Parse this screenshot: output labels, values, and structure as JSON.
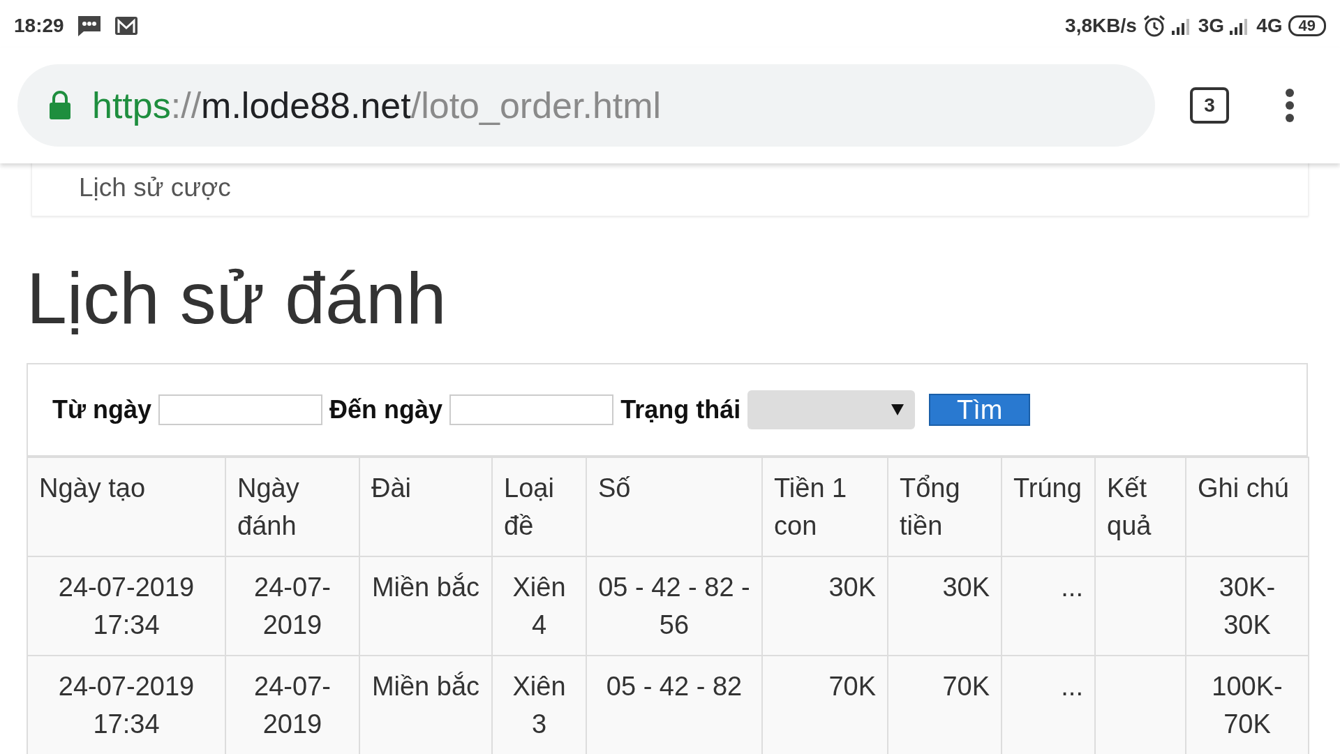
{
  "status_bar": {
    "time": "18:29",
    "speed": "3,8KB/s",
    "network_1": "3G",
    "network_2": "4G",
    "battery": "49"
  },
  "browser": {
    "url_scheme": "https",
    "url_sep": "://",
    "url_host": "m.lode88.net",
    "url_path": "/loto_order.html",
    "tab_count": "3"
  },
  "breadcrumb": "Lịch sử cược",
  "heading": "Lịch sử đánh",
  "filter": {
    "from_label": "Từ ngày",
    "to_label": "Đến ngày",
    "status_label": "Trạng thái",
    "search_button": "Tìm"
  },
  "table": {
    "columns": [
      "Ngày tạo",
      "Ngày đánh",
      "Đài",
      "Loại đề",
      "Số",
      "Tiền 1 con",
      "Tổng tiền",
      "Trúng",
      "Kết quả",
      "Ghi chú"
    ],
    "rows": [
      [
        "24-07-2019 17:34",
        "24-07-2019",
        "Miền bắc",
        "Xiên 4",
        "05 - 42 - 82 - 56",
        "30K",
        "30K",
        "...",
        "",
        "30K-30K"
      ],
      [
        "24-07-2019 17:34",
        "24-07-2019",
        "Miền bắc",
        "Xiên 3",
        "05 - 42 - 82",
        "70K",
        "70K",
        "...",
        "",
        "100K-70K"
      ]
    ]
  }
}
